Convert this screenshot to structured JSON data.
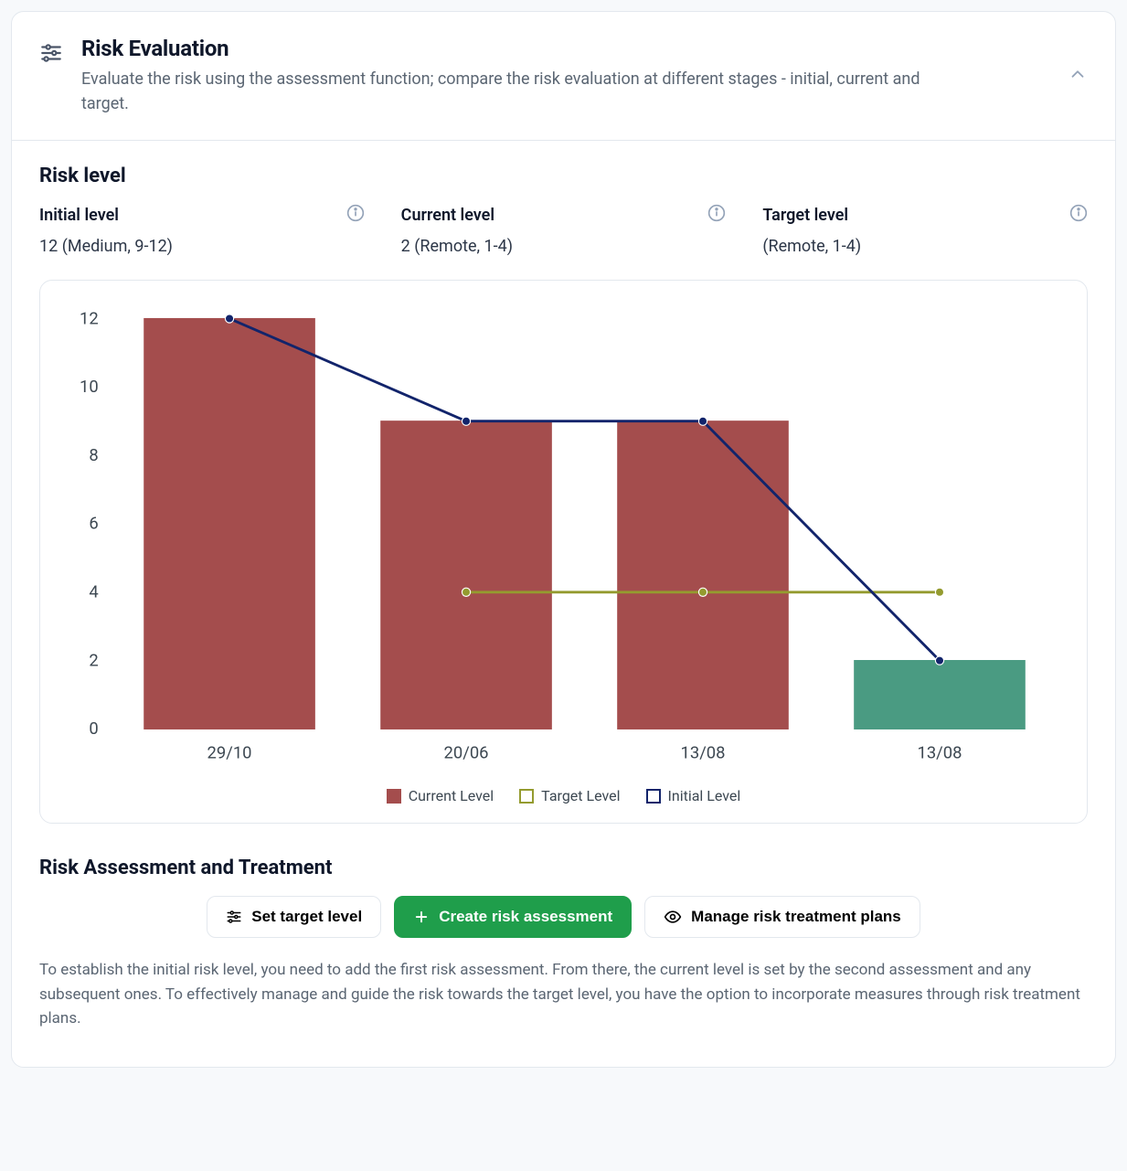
{
  "header": {
    "title": "Risk Evaluation",
    "description": "Evaluate the risk using the assessment function; compare the risk evaluation at different stages - initial, current and target."
  },
  "risk_level": {
    "title": "Risk level",
    "initial": {
      "label": "Initial level",
      "value": "12 (Medium, 9-12)"
    },
    "current": {
      "label": "Current level",
      "value": "2 (Remote, 1-4)"
    },
    "target": {
      "label": "Target level",
      "value": "(Remote, 1-4)"
    }
  },
  "chart_data": {
    "type": "bar",
    "categories": [
      "29/10",
      "20/06",
      "13/08",
      "13/08"
    ],
    "series": [
      {
        "name": "Current Level",
        "style": "bar",
        "color": "#a44d4d",
        "alt_color": "#4a9b82",
        "values": [
          12,
          9,
          9,
          2
        ],
        "alt_index": 3
      },
      {
        "name": "Target Level",
        "style": "line",
        "color": "#949b2f",
        "values": [
          null,
          4,
          4,
          4
        ]
      },
      {
        "name": "Initial Level",
        "style": "line",
        "color": "#12246b",
        "values": [
          12,
          9,
          9,
          2
        ]
      }
    ],
    "ylabel": "",
    "xlabel": "",
    "ylim": [
      0,
      12
    ],
    "yticks": [
      0,
      2,
      4,
      6,
      8,
      10,
      12
    ]
  },
  "legend": {
    "current": "Current Level",
    "target": "Target Level",
    "initial": "Initial Level"
  },
  "assessment": {
    "title": "Risk Assessment and Treatment",
    "set_target": "Set target level",
    "create": "Create risk assessment",
    "manage": "Manage risk treatment plans",
    "help": "To establish the initial risk level, you need to add the first risk assessment. From there, the current level is set by the second assessment and any subsequent ones. To effectively manage and guide the risk towards the target level, you have the option to incorporate measures through risk treatment plans."
  }
}
